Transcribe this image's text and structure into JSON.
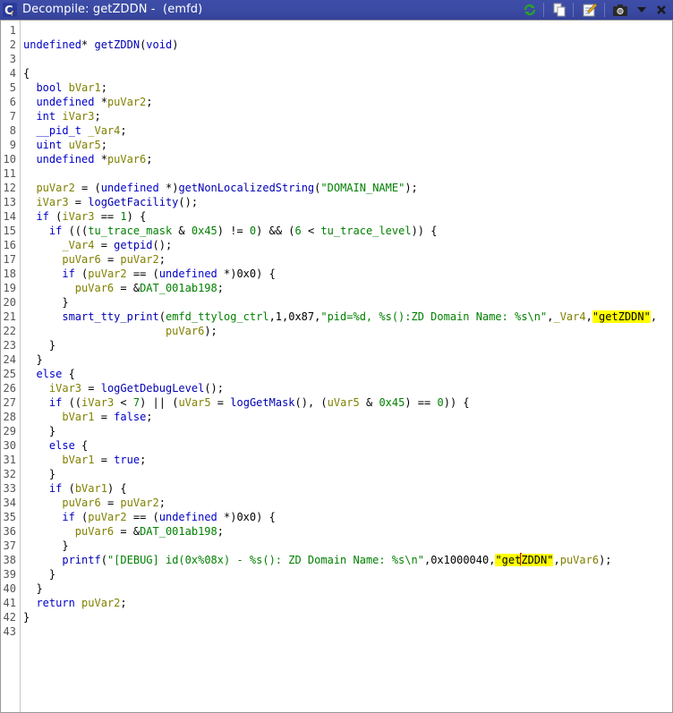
{
  "window": {
    "title": "Decompile: getZDDN -  (emfd)",
    "toolbar": [
      {
        "name": "refresh-icon",
        "icon": "refresh"
      },
      {
        "name": "copy-icon",
        "icon": "copy"
      },
      {
        "name": "edit-signature-icon",
        "icon": "edit"
      },
      {
        "name": "snapshot-icon",
        "icon": "camera"
      },
      {
        "name": "menu-chevron-icon",
        "icon": "chevron-down"
      }
    ]
  },
  "colors": {
    "titlebar": "#3b4aa3",
    "keyword": "#0000c8",
    "variable": "#808000",
    "global": "#008000",
    "highlight": "#ffff00",
    "cursor": "#e00000"
  },
  "lines": [
    {
      "n": "1",
      "segs": []
    },
    {
      "n": "2",
      "segs": [
        [
          "ty",
          "undefined"
        ],
        [
          "",
          "* "
        ],
        [
          "fn",
          "getZDDN"
        ],
        [
          "",
          "("
        ],
        [
          "ty",
          "void"
        ],
        [
          "",
          ")"
        ]
      ]
    },
    {
      "n": "3",
      "segs": []
    },
    {
      "n": "4",
      "segs": [
        [
          "",
          "{"
        ]
      ]
    },
    {
      "n": "5",
      "segs": [
        [
          "",
          "  "
        ],
        [
          "ty",
          "bool"
        ],
        [
          "",
          " "
        ],
        [
          "var",
          "bVar1"
        ],
        [
          "",
          ";"
        ]
      ]
    },
    {
      "n": "6",
      "segs": [
        [
          "",
          "  "
        ],
        [
          "ty",
          "undefined"
        ],
        [
          "",
          " *"
        ],
        [
          "var",
          "puVar2"
        ],
        [
          "",
          ";"
        ]
      ]
    },
    {
      "n": "7",
      "segs": [
        [
          "",
          "  "
        ],
        [
          "ty",
          "int"
        ],
        [
          "",
          " "
        ],
        [
          "var",
          "iVar3"
        ],
        [
          "",
          ";"
        ]
      ]
    },
    {
      "n": "8",
      "segs": [
        [
          "",
          "  "
        ],
        [
          "ty",
          "__pid_t"
        ],
        [
          "",
          " "
        ],
        [
          "var",
          "_Var4"
        ],
        [
          "",
          ";"
        ]
      ]
    },
    {
      "n": "9",
      "segs": [
        [
          "",
          "  "
        ],
        [
          "ty",
          "uint"
        ],
        [
          "",
          " "
        ],
        [
          "var",
          "uVar5"
        ],
        [
          "",
          ";"
        ]
      ]
    },
    {
      "n": "10",
      "segs": [
        [
          "",
          "  "
        ],
        [
          "ty",
          "undefined"
        ],
        [
          "",
          " *"
        ],
        [
          "var",
          "puVar6"
        ],
        [
          "",
          ";"
        ]
      ]
    },
    {
      "n": "11",
      "segs": []
    },
    {
      "n": "12",
      "segs": [
        [
          "",
          "  "
        ],
        [
          "var",
          "puVar2"
        ],
        [
          "",
          " = ("
        ],
        [
          "ty",
          "undefined"
        ],
        [
          "",
          " *)"
        ],
        [
          "fn",
          "getNonLocalizedString"
        ],
        [
          "",
          "("
        ],
        [
          "str",
          "\"DOMAIN_NAME\""
        ],
        [
          "",
          ");"
        ]
      ]
    },
    {
      "n": "13",
      "segs": [
        [
          "",
          "  "
        ],
        [
          "var",
          "iVar3"
        ],
        [
          "",
          " = "
        ],
        [
          "fn",
          "logGetFacility"
        ],
        [
          "",
          "();"
        ]
      ]
    },
    {
      "n": "14",
      "segs": [
        [
          "",
          "  "
        ],
        [
          "kw",
          "if"
        ],
        [
          "",
          " ("
        ],
        [
          "var",
          "iVar3"
        ],
        [
          "",
          " == "
        ],
        [
          "num",
          "1"
        ],
        [
          "",
          ") {"
        ]
      ]
    },
    {
      "n": "15",
      "segs": [
        [
          "",
          "    "
        ],
        [
          "kw",
          "if"
        ],
        [
          "",
          " ((("
        ],
        [
          "glob",
          "tu_trace_mask"
        ],
        [
          "",
          " & "
        ],
        [
          "num",
          "0x45"
        ],
        [
          "",
          ") != "
        ],
        [
          "num",
          "0"
        ],
        [
          "",
          ") && ("
        ],
        [
          "num",
          "6"
        ],
        [
          "",
          " < "
        ],
        [
          "glob",
          "tu_trace_level"
        ],
        [
          "",
          ")) {"
        ]
      ]
    },
    {
      "n": "16",
      "segs": [
        [
          "",
          "      "
        ],
        [
          "var",
          "_Var4"
        ],
        [
          "",
          " = "
        ],
        [
          "fn",
          "getpid"
        ],
        [
          "",
          "();"
        ]
      ]
    },
    {
      "n": "17",
      "segs": [
        [
          "",
          "      "
        ],
        [
          "var",
          "puVar6"
        ],
        [
          "",
          " = "
        ],
        [
          "var",
          "puVar2"
        ],
        [
          "",
          ";"
        ]
      ]
    },
    {
      "n": "18",
      "segs": [
        [
          "",
          "      "
        ],
        [
          "kw",
          "if"
        ],
        [
          "",
          " ("
        ],
        [
          "var",
          "puVar2"
        ],
        [
          "",
          " == ("
        ],
        [
          "ty",
          "undefined"
        ],
        [
          "",
          " *)0x0) {"
        ]
      ]
    },
    {
      "n": "19",
      "segs": [
        [
          "",
          "        "
        ],
        [
          "var",
          "puVar6"
        ],
        [
          "",
          " = &"
        ],
        [
          "glob",
          "DAT_001ab198"
        ],
        [
          "",
          ";"
        ]
      ]
    },
    {
      "n": "20",
      "segs": [
        [
          "",
          "      }"
        ]
      ]
    },
    {
      "n": "21",
      "segs": [
        [
          "",
          "      "
        ],
        [
          "fn",
          "smart_tty_print"
        ],
        [
          "",
          "("
        ],
        [
          "glob",
          "emfd_ttylog_ctrl"
        ],
        [
          "",
          ",1,0x87,"
        ],
        [
          "str",
          "\"pid=%d, %s():ZD Domain Name: %s\\n\""
        ],
        [
          "",
          ","
        ],
        [
          "var",
          "_Var4"
        ],
        [
          "",
          ","
        ],
        [
          "hl",
          "\"getZDDN\""
        ],
        [
          "",
          ","
        ]
      ]
    },
    {
      "n": "22",
      "segs": [
        [
          "",
          "                      "
        ],
        [
          "var",
          "puVar6"
        ],
        [
          "",
          ");"
        ]
      ]
    },
    {
      "n": "23",
      "segs": [
        [
          "",
          "    }"
        ]
      ]
    },
    {
      "n": "24",
      "segs": [
        [
          "",
          "  }"
        ]
      ]
    },
    {
      "n": "25",
      "segs": [
        [
          "",
          "  "
        ],
        [
          "kw",
          "else"
        ],
        [
          "",
          " {"
        ]
      ]
    },
    {
      "n": "26",
      "segs": [
        [
          "",
          "    "
        ],
        [
          "var",
          "iVar3"
        ],
        [
          "",
          " = "
        ],
        [
          "fn",
          "logGetDebugLevel"
        ],
        [
          "",
          "();"
        ]
      ]
    },
    {
      "n": "27",
      "segs": [
        [
          "",
          "    "
        ],
        [
          "kw",
          "if"
        ],
        [
          "",
          " (("
        ],
        [
          "var",
          "iVar3"
        ],
        [
          "",
          " < "
        ],
        [
          "num",
          "7"
        ],
        [
          "",
          ") || ("
        ],
        [
          "var",
          "uVar5"
        ],
        [
          "",
          " = "
        ],
        [
          "fn",
          "logGetMask"
        ],
        [
          "",
          "(), ("
        ],
        [
          "var",
          "uVar5"
        ],
        [
          "",
          " & "
        ],
        [
          "num",
          "0x45"
        ],
        [
          "",
          ") == "
        ],
        [
          "num",
          "0"
        ],
        [
          "",
          ")) {"
        ]
      ]
    },
    {
      "n": "28",
      "segs": [
        [
          "",
          "      "
        ],
        [
          "var",
          "bVar1"
        ],
        [
          "",
          " = "
        ],
        [
          "kw",
          "false"
        ],
        [
          "",
          ";"
        ]
      ]
    },
    {
      "n": "29",
      "segs": [
        [
          "",
          "    }"
        ]
      ]
    },
    {
      "n": "30",
      "segs": [
        [
          "",
          "    "
        ],
        [
          "kw",
          "else"
        ],
        [
          "",
          " {"
        ]
      ]
    },
    {
      "n": "31",
      "segs": [
        [
          "",
          "      "
        ],
        [
          "var",
          "bVar1"
        ],
        [
          "",
          " = "
        ],
        [
          "kw",
          "true"
        ],
        [
          "",
          ";"
        ]
      ]
    },
    {
      "n": "32",
      "segs": [
        [
          "",
          "    }"
        ]
      ]
    },
    {
      "n": "33",
      "segs": [
        [
          "",
          "    "
        ],
        [
          "kw",
          "if"
        ],
        [
          "",
          " ("
        ],
        [
          "var",
          "bVar1"
        ],
        [
          "",
          ") {"
        ]
      ]
    },
    {
      "n": "34",
      "segs": [
        [
          "",
          "      "
        ],
        [
          "var",
          "puVar6"
        ],
        [
          "",
          " = "
        ],
        [
          "var",
          "puVar2"
        ],
        [
          "",
          ";"
        ]
      ]
    },
    {
      "n": "35",
      "segs": [
        [
          "",
          "      "
        ],
        [
          "kw",
          "if"
        ],
        [
          "",
          " ("
        ],
        [
          "var",
          "puVar2"
        ],
        [
          "",
          " == ("
        ],
        [
          "ty",
          "undefined"
        ],
        [
          "",
          " *)0x0) {"
        ]
      ]
    },
    {
      "n": "36",
      "segs": [
        [
          "",
          "        "
        ],
        [
          "var",
          "puVar6"
        ],
        [
          "",
          " = &"
        ],
        [
          "glob",
          "DAT_001ab198"
        ],
        [
          "",
          ";"
        ]
      ]
    },
    {
      "n": "37",
      "segs": [
        [
          "",
          "      }"
        ]
      ]
    },
    {
      "n": "38",
      "segs": [
        [
          "",
          "      "
        ],
        [
          "fn",
          "printf"
        ],
        [
          "",
          "("
        ],
        [
          "str",
          "\"[DEBUG] id(0x%08x) - %s(): ZD Domain Name: %s\\n\""
        ],
        [
          "",
          ",0x1000040,"
        ],
        [
          "hl",
          "\"get"
        ],
        [
          "cursor",
          ""
        ],
        [
          "hl",
          "ZDDN\""
        ],
        [
          "",
          ","
        ],
        [
          "var",
          "puVar6"
        ],
        [
          "",
          ");"
        ]
      ]
    },
    {
      "n": "39",
      "segs": [
        [
          "",
          "    }"
        ]
      ]
    },
    {
      "n": "40",
      "segs": [
        [
          "",
          "  }"
        ]
      ]
    },
    {
      "n": "41",
      "segs": [
        [
          "",
          "  "
        ],
        [
          "kw",
          "return"
        ],
        [
          "",
          " "
        ],
        [
          "var",
          "puVar2"
        ],
        [
          "",
          ";"
        ]
      ]
    },
    {
      "n": "42",
      "segs": [
        [
          "",
          "}"
        ]
      ]
    },
    {
      "n": "43",
      "segs": []
    }
  ]
}
